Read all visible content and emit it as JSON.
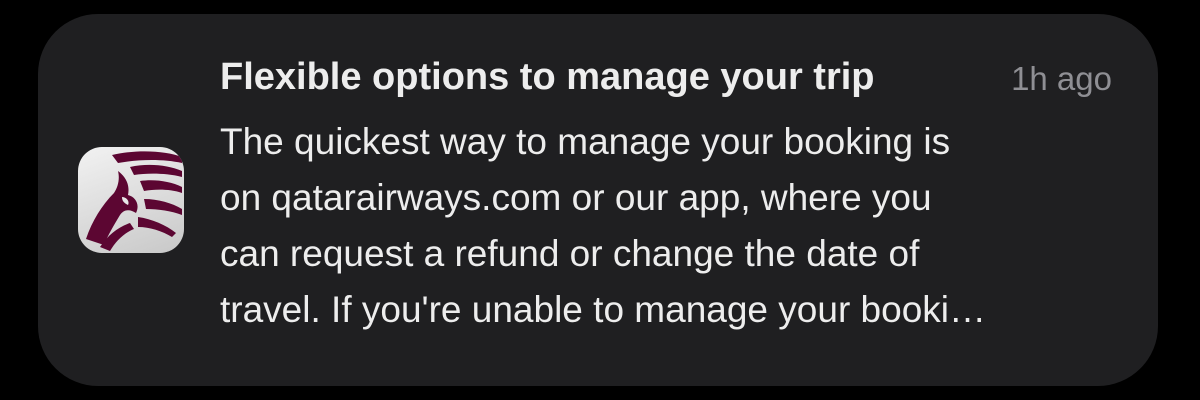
{
  "notification": {
    "app_icon": "qatar-airways-oryx-logo",
    "title": "Flexible options to manage your trip",
    "timestamp": "1h ago",
    "body_lines": [
      "The quickest way to manage your booking is",
      "on qatarairways.com or our app, where you",
      "can request a refund or change the date of",
      "travel. If you're unable to manage your booki…"
    ]
  },
  "colors": {
    "background": "#000000",
    "card": "#1f1f21",
    "text_primary": "#ededed",
    "text_secondary": "#8f8f94",
    "brand_maroon": "#5c0632"
  }
}
